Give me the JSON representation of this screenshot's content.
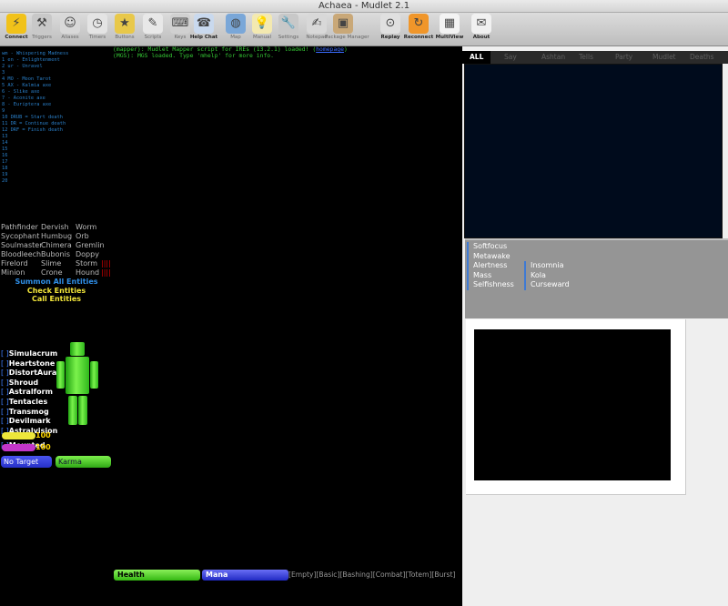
{
  "window": {
    "title": "Achaea - Mudlet 2.1"
  },
  "toolbar": [
    {
      "label": "Connect",
      "icon": "connect-icon",
      "bold": true
    },
    {
      "label": "Triggers",
      "icon": "triggers-icon",
      "bold": false
    },
    {
      "label": "Aliases",
      "icon": "aliases-icon",
      "bold": false
    },
    {
      "label": "Timers",
      "icon": "timers-icon",
      "bold": false
    },
    {
      "label": "Buttons",
      "icon": "buttons-icon",
      "bold": false
    },
    {
      "label": "Scripts",
      "icon": "scripts-icon",
      "bold": false
    },
    {
      "label": "Keys",
      "icon": "keys-icon",
      "bold": false
    },
    {
      "label": "Help Chat",
      "icon": "help-chat-icon",
      "bold": true
    },
    {
      "label": "Map",
      "icon": "map-icon",
      "bold": false
    },
    {
      "label": "Manual",
      "icon": "manual-icon",
      "bold": false
    },
    {
      "label": "Settings",
      "icon": "settings-icon",
      "bold": false
    },
    {
      "label": "Notepad",
      "icon": "notepad-icon",
      "bold": false
    },
    {
      "label": "Package Manager",
      "icon": "package-manager-icon",
      "bold": false
    },
    {
      "label": "Replay",
      "icon": "replay-icon",
      "bold": true
    },
    {
      "label": "Reconnect",
      "icon": "reconnect-icon",
      "bold": true
    },
    {
      "label": "MultiView",
      "icon": "multiview-icon",
      "bold": true
    },
    {
      "label": "About",
      "icon": "about-icon",
      "bold": true
    }
  ],
  "target_list": [
    "wm - Whispering Madness",
    "1 en - Enlightenment",
    "2 ur - Unravel",
    "3",
    "4 MO - Moon Tarot",
    "5 AX - Kalmia axe",
    "6 - Slike axe",
    "7 - Aconite axe",
    "8 - Euriptera axe",
    "9",
    "10 DRUB = Start death",
    "11 DR = Continue death",
    "12 DRF = Finish death",
    "13",
    "14",
    "15",
    "16",
    "17",
    "18",
    "19",
    "20"
  ],
  "entities": [
    [
      "Pathfinder",
      "Dervish",
      "Worm",
      ""
    ],
    [
      "Sycophant",
      "Humbug",
      "Orb",
      ""
    ],
    [
      "Soulmaster",
      "Chimera",
      "Gremlin",
      ""
    ],
    [
      "Bloodleech",
      "Bubonis",
      "Doppy",
      ""
    ],
    [
      "Firelord",
      "Slime",
      "Storm",
      "||||"
    ],
    [
      "Minion",
      "Crone",
      "Hound",
      "||||"
    ]
  ],
  "entity_commands": [
    {
      "label": "Summon All Entities",
      "color": "#2f8fe8"
    },
    {
      "label": "Check Entities",
      "color": "#f2e53a"
    },
    {
      "label": "Call Entities",
      "color": "#f2e53a"
    }
  ],
  "defences": [
    {
      "bracket": "[  ]",
      "name": "Simulacrum"
    },
    {
      "bracket": "[  ]",
      "name": "Heartstone"
    },
    {
      "bracket": "[  ]",
      "name": "DistortAura"
    },
    {
      "bracket": "[  ]",
      "name": "Shroud"
    },
    {
      "bracket": "[  ]",
      "name": "Astralform"
    },
    {
      "bracket": "[  ]",
      "name": "Tentacles"
    },
    {
      "bracket": "[  ]",
      "name": "Transmog"
    },
    {
      "bracket": "[  ]",
      "name": "Devilmark"
    },
    {
      "bracket": "[  ]",
      "name": "Astralvision"
    }
  ],
  "mounted": {
    "bracket": "[  ]",
    "name": "Mounted"
  },
  "vitals_small": [
    {
      "value": "100",
      "percent": 100,
      "color": "#ede63b"
    },
    {
      "value": "100",
      "percent": 100,
      "color": "#c236c9"
    }
  ],
  "target_button": "No Target",
  "karma_button": "Karma",
  "console": [
    {
      "prefix": "(mapper): ",
      "text": "Mudlet Mapper script for IREs (13.2.1) loaded! (",
      "link": "homepage",
      "suffix": ")"
    },
    {
      "prefix": "(MGS): ",
      "text": "MGS loaded. Type 'mhelp' for more info.",
      "link": "",
      "suffix": ""
    }
  ],
  "bottom": {
    "health_label": "Health",
    "mana_label": "Mana",
    "modes": "[Empty][Basic][Bashing][Combat][Totem][Burst]"
  },
  "chat_tabs": [
    "ALL",
    "Say",
    "Ashtan",
    "Tells",
    "Party",
    "Mudlet",
    "Deaths"
  ],
  "afflictions_col1": [
    "Softfocus",
    "Metawake",
    "Alertness",
    "Mass",
    "Selfishness"
  ],
  "afflictions_col2": [
    "Insomnia",
    "Kola",
    "Curseward"
  ],
  "colors": {
    "accent_blue": "#2f8fe8",
    "yellow": "#f2e53a",
    "green": "#4dd01a",
    "entity_grey": "#b8b8b8"
  }
}
